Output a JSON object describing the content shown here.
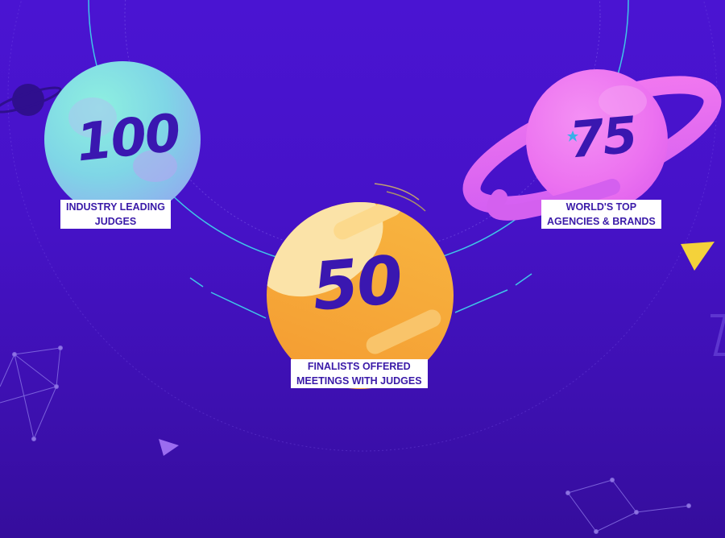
{
  "stats": [
    {
      "number": "100",
      "line1": "INDUSTRY LEADING",
      "line2": "JUDGES"
    },
    {
      "number": "50",
      "line1": "FINALISTS OFFERED",
      "line2": "MEETINGS WITH JUDGES"
    },
    {
      "number": "75",
      "line1": "WORLD'S TOP",
      "line2": "AGENCIES & BRANDS"
    }
  ],
  "colors": {
    "background": "#4a14d2",
    "orbit_line": "#3fc6e8",
    "planet_teal": "#6ee6dc",
    "planet_orange": "#f7a838",
    "planet_pink": "#f06cf0",
    "number_text": "#3a17b0",
    "label_text": "#3a1aa8"
  },
  "icons": [
    "saturn-planet-icon",
    "small-planet-icon",
    "triangle-icon",
    "constellation-icon"
  ]
}
